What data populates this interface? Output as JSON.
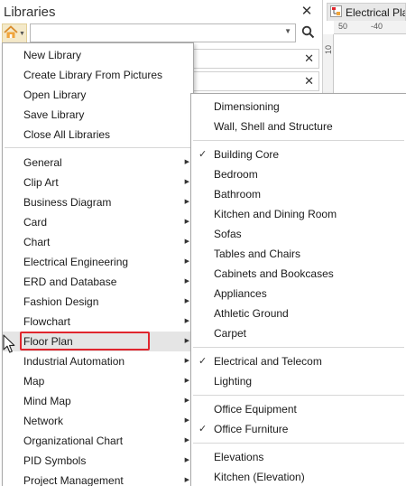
{
  "panel": {
    "title": "Libraries",
    "close_glyph": "✕",
    "search": {
      "value": "",
      "placeholder": ""
    },
    "row_close_glyph": "✕"
  },
  "document": {
    "tab_title": "Electrical Plan",
    "ruler_top_labels": [
      "50",
      "-40"
    ],
    "ruler_left_label": "10"
  },
  "menu": {
    "top_items": [
      "New Library",
      "Create Library From Pictures",
      "Open Library",
      "Save Library",
      "Close All Libraries"
    ],
    "categories": [
      "General",
      "Clip Art",
      "Business Diagram",
      "Card",
      "Chart",
      "Electrical Engineering",
      "ERD and Database",
      "Fashion Design",
      "Flowchart",
      "Floor Plan",
      "Industrial Automation",
      "Map",
      "Mind Map",
      "Network",
      "Organizational Chart",
      "PID Symbols",
      "Project Management"
    ],
    "highlighted": "Floor Plan"
  },
  "submenu": {
    "groups": [
      [
        {
          "label": "Dimensioning",
          "checked": false
        },
        {
          "label": "Wall, Shell and Structure",
          "checked": false
        }
      ],
      [
        {
          "label": "Building Core",
          "checked": true
        },
        {
          "label": "Bedroom",
          "checked": false
        },
        {
          "label": "Bathroom",
          "checked": false
        },
        {
          "label": "Kitchen and Dining Room",
          "checked": false
        },
        {
          "label": "Sofas",
          "checked": false
        },
        {
          "label": "Tables and Chairs",
          "checked": false
        },
        {
          "label": "Cabinets and Bookcases",
          "checked": false
        },
        {
          "label": "Appliances",
          "checked": false
        },
        {
          "label": "Athletic Ground",
          "checked": false
        },
        {
          "label": "Carpet",
          "checked": false
        }
      ],
      [
        {
          "label": "Electrical and Telecom",
          "checked": true
        },
        {
          "label": "Lighting",
          "checked": false
        }
      ],
      [
        {
          "label": "Office Equipment",
          "checked": false
        },
        {
          "label": "Office Furniture",
          "checked": true
        }
      ],
      [
        {
          "label": "Elevations",
          "checked": false
        },
        {
          "label": "Kitchen (Elevation)",
          "checked": false
        }
      ]
    ]
  },
  "colors": {
    "highlight_outline": "#e0262e",
    "library_button_bg": "#f4e9c9"
  },
  "icons": {
    "library": "home-library-icon",
    "search": "search-icon",
    "check": "check-icon",
    "submenu_arrow": "triangle-right-icon"
  }
}
